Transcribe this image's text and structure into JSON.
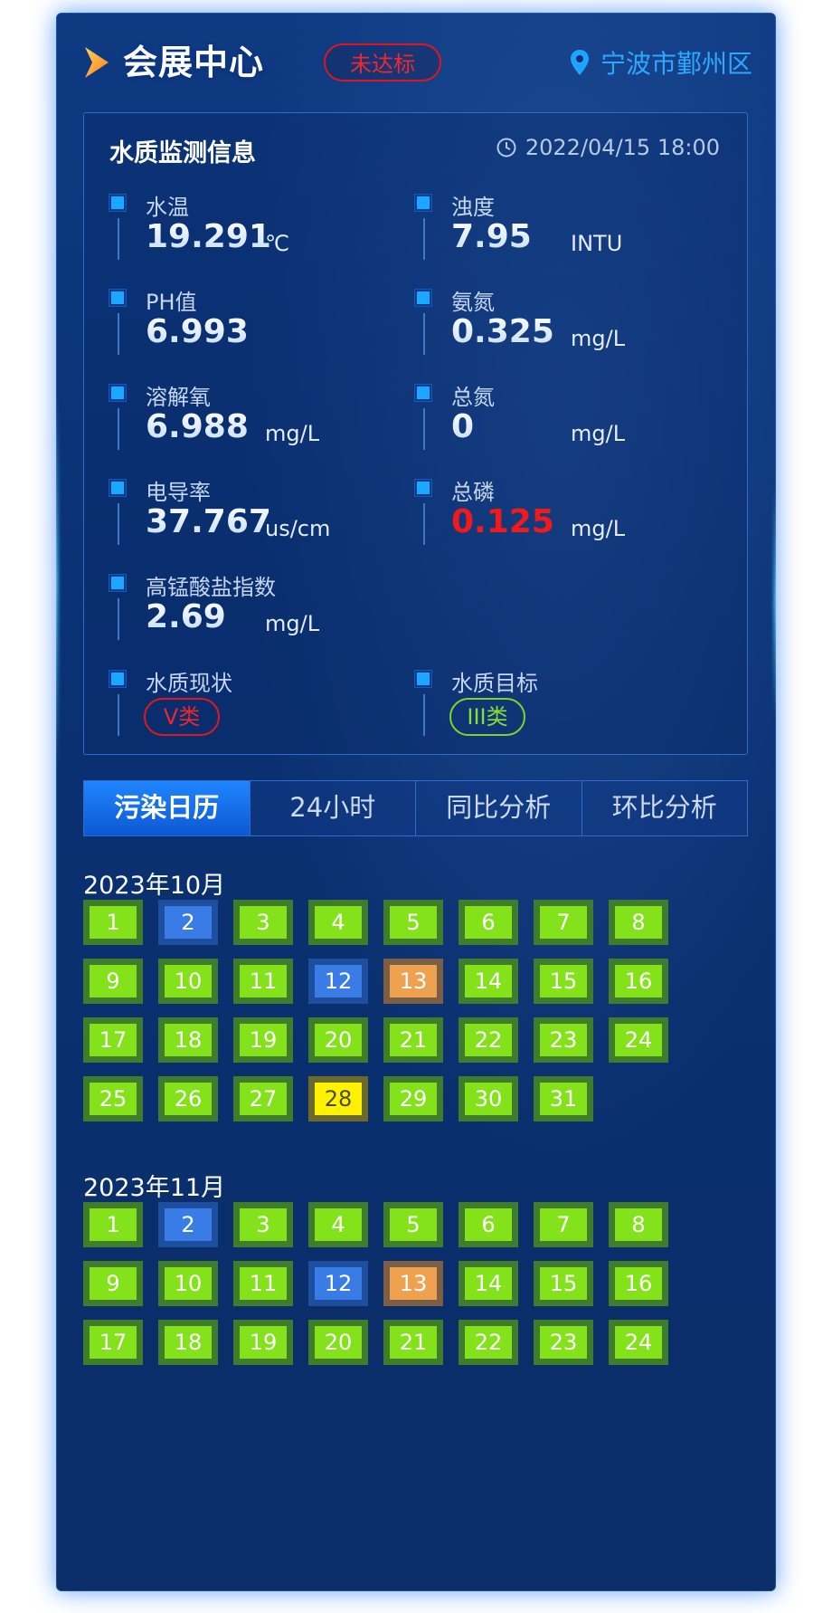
{
  "header": {
    "title": "会展中心",
    "status_badge": "未达标",
    "location": "宁波市鄞州区"
  },
  "monitor": {
    "title": "水质监测信息",
    "datetime": "2022/04/15   18:00",
    "metrics": [
      {
        "label": "水温",
        "value": "19.291",
        "unit": "℃"
      },
      {
        "label": "浊度",
        "value": "7.95",
        "unit": "INTU"
      },
      {
        "label": "PH值",
        "value": "6.993",
        "unit": ""
      },
      {
        "label": "氨氮",
        "value": "0.325",
        "unit": "mg/L"
      },
      {
        "label": "溶解氧",
        "value": "6.988",
        "unit": "mg/L"
      },
      {
        "label": "总氮",
        "value": "0",
        "unit": "mg/L"
      },
      {
        "label": "电导率",
        "value": "37.767",
        "unit": "us/cm"
      },
      {
        "label": "总磷",
        "value": "0.125",
        "unit": "mg/L",
        "alert": true
      },
      {
        "label": "高锰酸盐指数",
        "value": "2.69",
        "unit": "mg/L"
      }
    ],
    "current_quality": {
      "label": "水质现状",
      "grade": "V类"
    },
    "target_quality": {
      "label": "水质目标",
      "grade": "III类"
    }
  },
  "tabs": [
    {
      "label": "污染日历",
      "active": true
    },
    {
      "label": "24小时",
      "active": false
    },
    {
      "label": "同比分析",
      "active": false
    },
    {
      "label": "环比分析",
      "active": false
    }
  ],
  "status_colors": {
    "green": "#84e21b",
    "blue": "#3a7ce6",
    "orange": "#eea24f",
    "yellow": "#fff200",
    "alert_red": "#f11a1a"
  },
  "calendar": [
    {
      "month": "2023年10月",
      "days": [
        {
          "d": "1",
          "s": "green"
        },
        {
          "d": "2",
          "s": "blue"
        },
        {
          "d": "3",
          "s": "green"
        },
        {
          "d": "4",
          "s": "green"
        },
        {
          "d": "5",
          "s": "green"
        },
        {
          "d": "6",
          "s": "green"
        },
        {
          "d": "7",
          "s": "green"
        },
        {
          "d": "8",
          "s": "green"
        },
        {
          "d": "9",
          "s": "green"
        },
        {
          "d": "10",
          "s": "green"
        },
        {
          "d": "11",
          "s": "green"
        },
        {
          "d": "12",
          "s": "blue"
        },
        {
          "d": "13",
          "s": "orange"
        },
        {
          "d": "14",
          "s": "green"
        },
        {
          "d": "15",
          "s": "green"
        },
        {
          "d": "16",
          "s": "green"
        },
        {
          "d": "17",
          "s": "green"
        },
        {
          "d": "18",
          "s": "green"
        },
        {
          "d": "19",
          "s": "green"
        },
        {
          "d": "20",
          "s": "green"
        },
        {
          "d": "21",
          "s": "green"
        },
        {
          "d": "22",
          "s": "green"
        },
        {
          "d": "23",
          "s": "green"
        },
        {
          "d": "24",
          "s": "green"
        },
        {
          "d": "25",
          "s": "green"
        },
        {
          "d": "26",
          "s": "green"
        },
        {
          "d": "27",
          "s": "green"
        },
        {
          "d": "28",
          "s": "yellow"
        },
        {
          "d": "29",
          "s": "green"
        },
        {
          "d": "30",
          "s": "green"
        },
        {
          "d": "31",
          "s": "green"
        }
      ]
    },
    {
      "month": "2023年11月",
      "days": [
        {
          "d": "1",
          "s": "green"
        },
        {
          "d": "2",
          "s": "blue"
        },
        {
          "d": "3",
          "s": "green"
        },
        {
          "d": "4",
          "s": "green"
        },
        {
          "d": "5",
          "s": "green"
        },
        {
          "d": "6",
          "s": "green"
        },
        {
          "d": "7",
          "s": "green"
        },
        {
          "d": "8",
          "s": "green"
        },
        {
          "d": "9",
          "s": "green"
        },
        {
          "d": "10",
          "s": "green"
        },
        {
          "d": "11",
          "s": "green"
        },
        {
          "d": "12",
          "s": "blue"
        },
        {
          "d": "13",
          "s": "orange"
        },
        {
          "d": "14",
          "s": "green"
        },
        {
          "d": "15",
          "s": "green"
        },
        {
          "d": "16",
          "s": "green"
        },
        {
          "d": "17",
          "s": "green"
        },
        {
          "d": "18",
          "s": "green"
        },
        {
          "d": "19",
          "s": "green"
        },
        {
          "d": "20",
          "s": "green"
        },
        {
          "d": "21",
          "s": "green"
        },
        {
          "d": "22",
          "s": "green"
        },
        {
          "d": "23",
          "s": "green"
        },
        {
          "d": "24",
          "s": "green"
        }
      ]
    }
  ]
}
